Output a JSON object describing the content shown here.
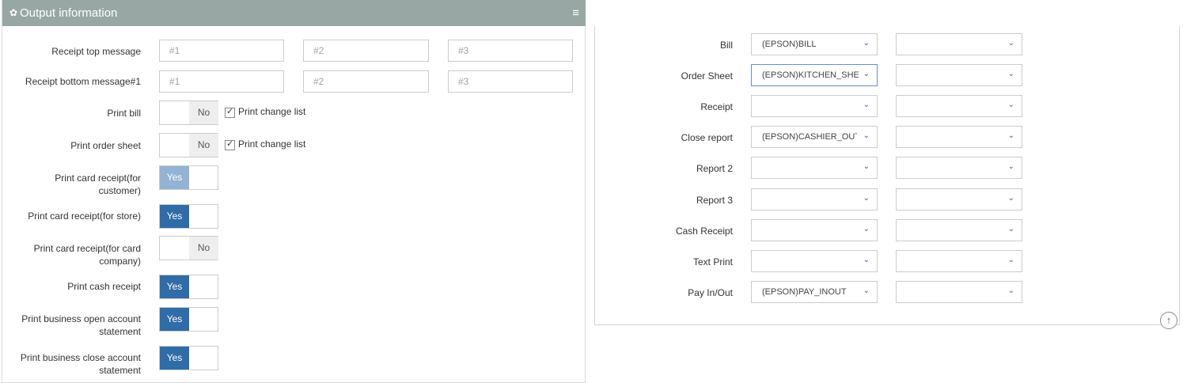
{
  "header": {
    "title": "Output information"
  },
  "messages": {
    "top_label": "Receipt top message",
    "bottom_label": "Receipt bottom message#1",
    "placeholders": [
      "#1",
      "#2",
      "#3"
    ]
  },
  "toggles": [
    {
      "label": "Print bill",
      "value": "No",
      "checkbox_label": "Print change list",
      "checked": true
    },
    {
      "label": "Print order sheet",
      "value": "No",
      "checkbox_label": "Print change list",
      "checked": true
    },
    {
      "label": "Print card receipt(for customer)",
      "value": "Yes"
    },
    {
      "label": "Print card receipt(for store)",
      "value": "Yes"
    },
    {
      "label": "Print card receipt(for card company)",
      "value": "No"
    },
    {
      "label": "Print cash receipt",
      "value": "Yes"
    },
    {
      "label": "Print business open account statement",
      "value": "Yes"
    },
    {
      "label": "Print business close account statement",
      "value": "Yes"
    }
  ],
  "printers": [
    {
      "label": "Bill",
      "primary": "(EPSON)BILL",
      "secondary": ""
    },
    {
      "label": "Order Sheet",
      "primary": "(EPSON)KITCHEN_SHEET",
      "secondary": ""
    },
    {
      "label": "Receipt",
      "primary": "",
      "secondary": ""
    },
    {
      "label": "Close report",
      "primary": "(EPSON)CASHIER_OUT",
      "secondary": ""
    },
    {
      "label": "Report 2",
      "primary": "",
      "secondary": ""
    },
    {
      "label": "Report 3",
      "primary": "",
      "secondary": ""
    },
    {
      "label": "Cash Receipt",
      "primary": "",
      "secondary": ""
    },
    {
      "label": "Text Print",
      "primary": "",
      "secondary": ""
    },
    {
      "label": "Pay In/Out",
      "primary": "(EPSON)PAY_INOUT",
      "secondary": ""
    }
  ],
  "icons": {
    "header": "gear-icon",
    "menu": "hamburger-menu-icon",
    "scroll": "scroll-to-top-icon"
  }
}
